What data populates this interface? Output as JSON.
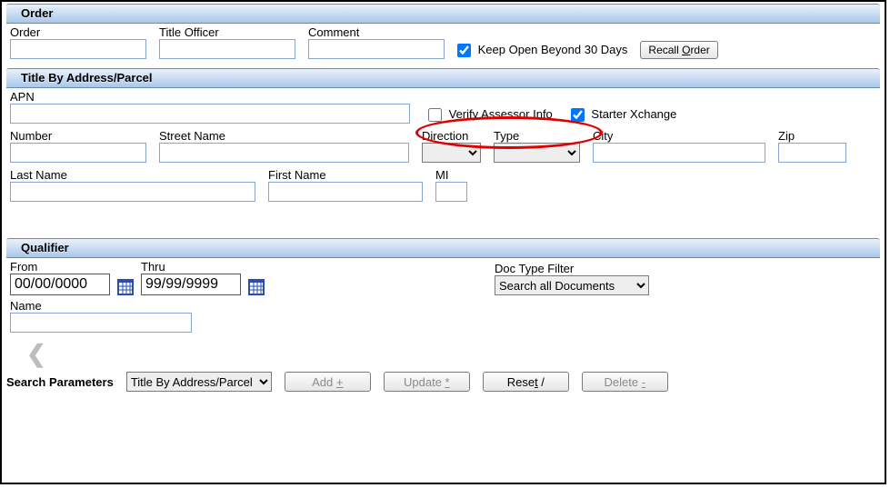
{
  "order": {
    "header": "Order",
    "order_label": "Order",
    "order_value": "",
    "title_officer_label": "Title Officer",
    "title_officer_value": "",
    "comment_label": "Comment",
    "comment_value": "",
    "keep_open_label": "Keep Open Beyond 30 Days",
    "keep_open_checked": true,
    "recall_btn_prefix": "Recall ",
    "recall_btn_access": "O",
    "recall_btn_suffix": "rder"
  },
  "title_by": {
    "header": "Title By Address/Parcel",
    "apn_label": "APN",
    "apn_value": "",
    "verify_label": "Verify Assessor Info",
    "verify_checked": false,
    "starter_label": "Starter Xchange",
    "starter_checked": true,
    "number_label": "Number",
    "number_value": "",
    "street_label": "Street Name",
    "street_value": "",
    "direction_label": "Direction",
    "direction_value": "",
    "type_label": "Type",
    "type_value": "",
    "city_label": "City",
    "city_value": "",
    "zip_label": "Zip",
    "zip_value": "",
    "lastname_label": "Last Name",
    "lastname_value": "",
    "firstname_label": "First Name",
    "firstname_value": "",
    "mi_label": "MI",
    "mi_value": ""
  },
  "qualifier": {
    "header": "Qualifier",
    "from_label": "From",
    "from_value": "00/00/0000",
    "thru_label": "Thru",
    "thru_value": "99/99/9999",
    "doc_filter_label": "Doc Type Filter",
    "doc_filter_value": "Search all Documents",
    "name_label": "Name",
    "name_value": ""
  },
  "footer": {
    "search_params_label": "Search Parameters",
    "selector_value": "Title By Address/Parcel",
    "add_prefix": "Add ",
    "add_access": "+",
    "update_prefix": "Update ",
    "update_access": "*",
    "reset_prefix": "Rese",
    "reset_access": "t",
    "reset_suffix": " /",
    "delete_prefix": "Delete ",
    "delete_access": "-"
  }
}
